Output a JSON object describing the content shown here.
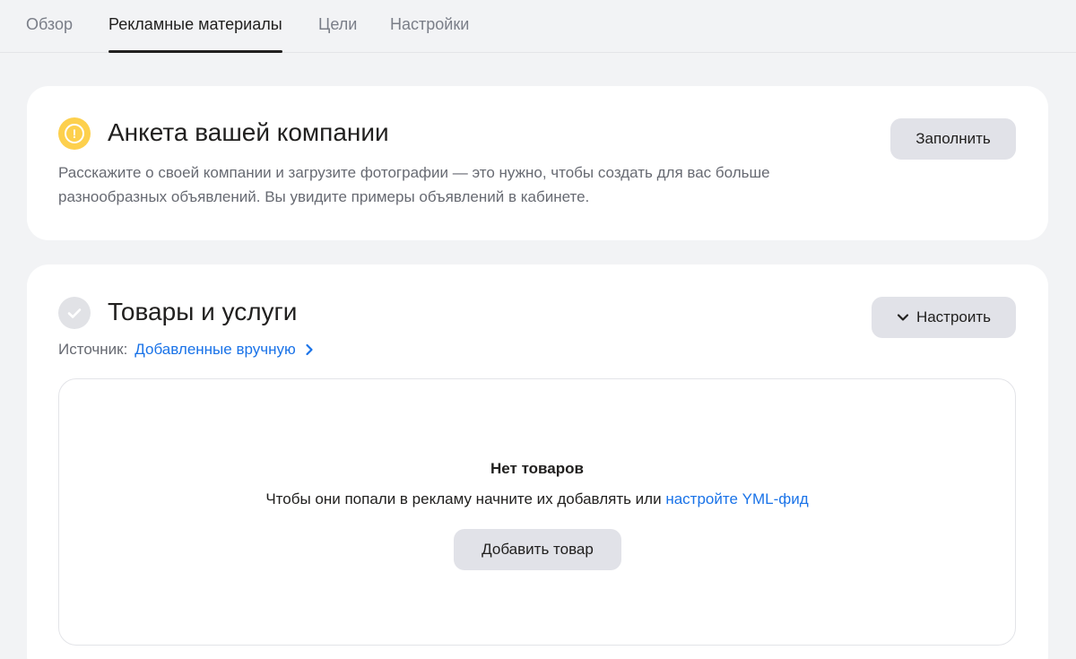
{
  "tabs": [
    {
      "label": "Обзор",
      "active": false
    },
    {
      "label": "Рекламные материалы",
      "active": true
    },
    {
      "label": "Цели",
      "active": false
    },
    {
      "label": "Настройки",
      "active": false
    }
  ],
  "company_card": {
    "icon": "warning-icon",
    "title": "Анкета вашей компании",
    "description": "Расскажите о своей компании и загрузите фотографии — это нужно, чтобы создать для вас больше разнообразных объявлений. Вы увидите примеры объявлений в кабинете.",
    "fill_button": "Заполнить"
  },
  "products_card": {
    "icon": "check-icon",
    "title": "Товары и услуги",
    "setup_button": "Настроить",
    "source_label": "Источник:",
    "source_link": "Добавленные вручную",
    "empty": {
      "title": "Нет товаров",
      "text": "Чтобы они попали в рекламу начните их добавлять или ",
      "link": "настройте YML-фид",
      "add_button": "Добавить товар"
    }
  },
  "colors": {
    "warning": "#fdd04d",
    "link": "#1a73e8",
    "button_bg": "#e1e2e8",
    "page_bg": "#f2f3f5"
  }
}
